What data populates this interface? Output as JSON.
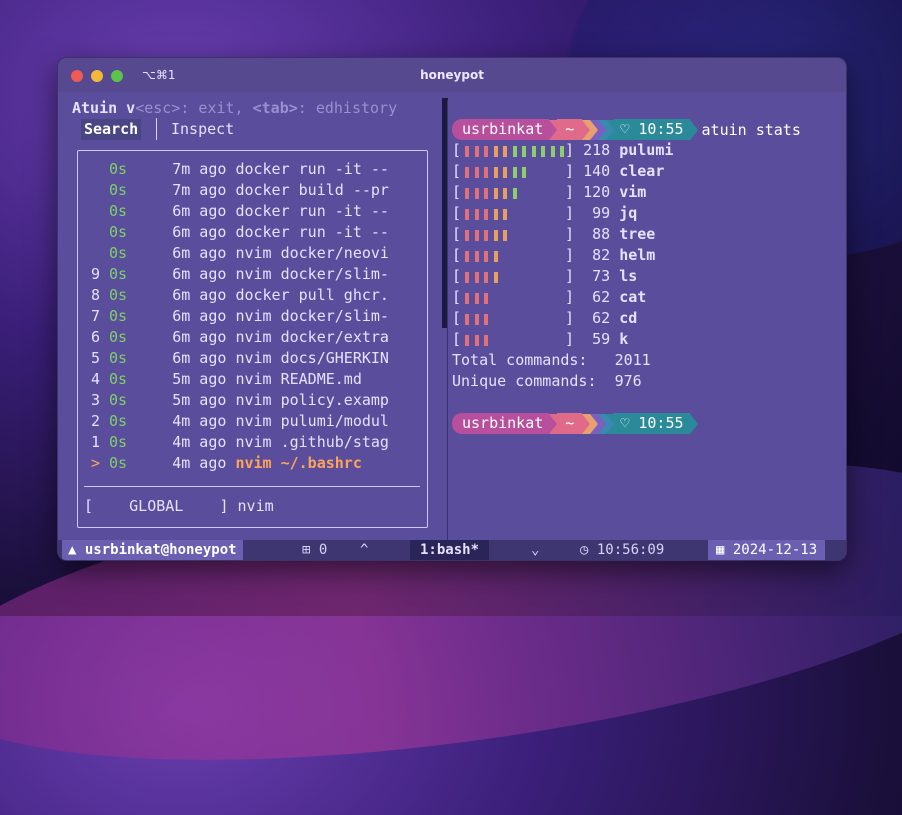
{
  "window": {
    "title": "honeypot",
    "shortcut": "⌥⌘1"
  },
  "left_pane": {
    "header_prefix": "Atuin v",
    "header_hint_esc": "<esc>",
    "header_hint_exit": ": exit, ",
    "header_hint_tab": "<tab>",
    "header_hint_rest": ": edhistory",
    "tabs": [
      "Search",
      "Inspect"
    ],
    "history": [
      {
        "n": "",
        "dur": "0s",
        "ago": "7m ago",
        "cmd": "docker run -it --"
      },
      {
        "n": "",
        "dur": "0s",
        "ago": "7m ago",
        "cmd": "docker build --pr"
      },
      {
        "n": "",
        "dur": "0s",
        "ago": "6m ago",
        "cmd": "docker run -it --"
      },
      {
        "n": "",
        "dur": "0s",
        "ago": "6m ago",
        "cmd": "docker run -it --"
      },
      {
        "n": "",
        "dur": "0s",
        "ago": "6m ago",
        "cmd": "nvim docker/neovi"
      },
      {
        "n": "9",
        "dur": "0s",
        "ago": "6m ago",
        "cmd": "nvim docker/slim-"
      },
      {
        "n": "8",
        "dur": "0s",
        "ago": "6m ago",
        "cmd": "docker pull ghcr."
      },
      {
        "n": "7",
        "dur": "0s",
        "ago": "6m ago",
        "cmd": "nvim docker/slim-"
      },
      {
        "n": "6",
        "dur": "0s",
        "ago": "6m ago",
        "cmd": "nvim docker/extra"
      },
      {
        "n": "5",
        "dur": "0s",
        "ago": "6m ago",
        "cmd": "nvim docs/GHERKIN"
      },
      {
        "n": "4",
        "dur": "0s",
        "ago": "5m ago",
        "cmd": "nvim README.md"
      },
      {
        "n": "3",
        "dur": "0s",
        "ago": "5m ago",
        "cmd": "nvim policy.examp"
      },
      {
        "n": "2",
        "dur": "0s",
        "ago": "4m ago",
        "cmd": "nvim pulumi/modul"
      },
      {
        "n": "1",
        "dur": "0s",
        "ago": "4m ago",
        "cmd": "nvim .github/stag"
      },
      {
        "n": ">",
        "dur": "0s",
        "ago": "4m ago",
        "cmd": "nvim ~/.bashrc"
      }
    ],
    "filter_mode": "[    GLOBAL    ]",
    "query": "nvim"
  },
  "right_pane": {
    "prompt": {
      "user": "usrbinkat",
      "dir": "~",
      "time": "♡ 10:55",
      "command": "atuin stats"
    },
    "stats": [
      {
        "count": "218",
        "name": "pulumi",
        "bars": 11
      },
      {
        "count": "140",
        "name": "clear",
        "bars": 7
      },
      {
        "count": "120",
        "name": "vim",
        "bars": 6
      },
      {
        "count": " 99",
        "name": "jq",
        "bars": 5
      },
      {
        "count": " 88",
        "name": "tree",
        "bars": 5
      },
      {
        "count": " 82",
        "name": "helm",
        "bars": 4
      },
      {
        "count": " 73",
        "name": "ls",
        "bars": 4
      },
      {
        "count": " 62",
        "name": "cat",
        "bars": 3
      },
      {
        "count": " 62",
        "name": "cd",
        "bars": 3
      },
      {
        "count": " 59",
        "name": "k",
        "bars": 3
      }
    ],
    "total_label": "Total commands:",
    "total_value": "2011",
    "unique_label": "Unique commands:",
    "unique_value": "976",
    "prompt2": {
      "user": "usrbinkat",
      "dir": "~",
      "time": "♡ 10:55"
    }
  },
  "statusbar": {
    "user_host": "usrbinkat@honeypot",
    "sessions": "⊞ 0",
    "up": "^",
    "window": "1:bash*",
    "down": "⌄",
    "time": "◷ 10:56:09",
    "date": "▦ 2024-12-13"
  },
  "colors": {
    "bar_red": "#e0707a",
    "bar_orange": "#e8a060",
    "bar_green": "#8ccf6a",
    "duration": "#7fd06a",
    "selected": "#ffa35a"
  }
}
